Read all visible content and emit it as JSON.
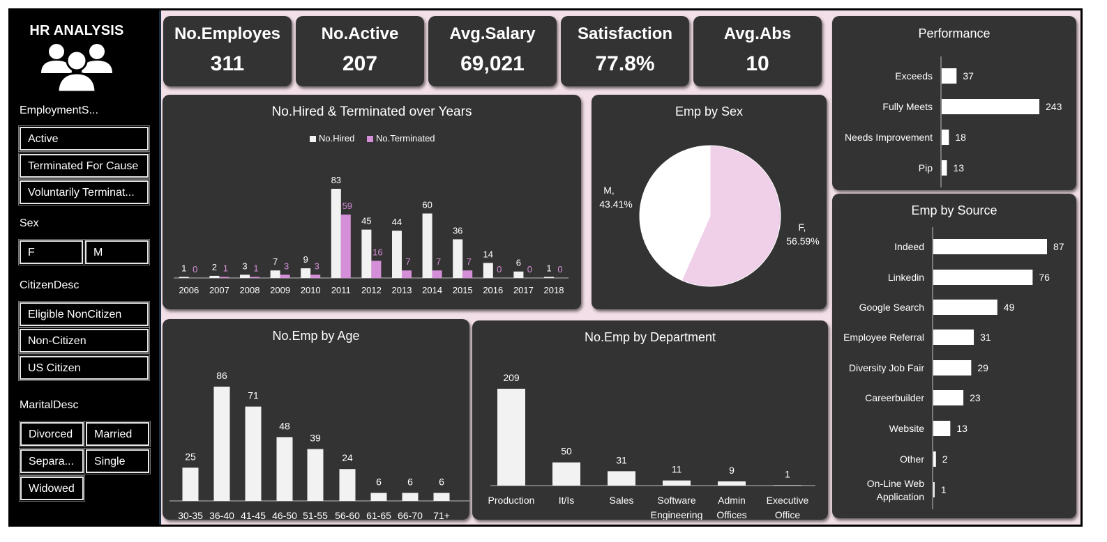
{
  "brand": {
    "title": "HR ANALYSIS",
    "icon": "people-group-icon"
  },
  "slicers": {
    "employment": {
      "title": "EmploymentS...",
      "items": [
        "Active",
        "Terminated For Cause",
        "Voluntarily Terminat..."
      ]
    },
    "sex": {
      "title": "Sex",
      "items": [
        "F",
        "M"
      ]
    },
    "citizen": {
      "title": "CitizenDesc",
      "items": [
        "Eligible NonCitizen",
        "Non-Citizen",
        "US Citizen"
      ]
    },
    "marital": {
      "title": "MaritalDesc",
      "items": [
        "Divorced",
        "Married",
        "Separa...",
        "Single",
        "Widowed"
      ]
    }
  },
  "kpis": [
    {
      "label": "No.Employes",
      "value": "311"
    },
    {
      "label": "No.Active",
      "value": "207"
    },
    {
      "label": "Avg.Salary",
      "value": "69,021"
    },
    {
      "label": "Satisfaction",
      "value": "77.8%"
    },
    {
      "label": "Avg.Abs",
      "value": "10"
    }
  ],
  "colors": {
    "background": "#f2dfe7",
    "card": "#333333",
    "hired": "#f2f2f2",
    "terminated": "#d58fd8",
    "female": "#f0cfe8",
    "male": "#ffffff"
  },
  "chart_data": [
    {
      "id": "hired_terminated",
      "type": "bar",
      "title": "No.Hired & Terminated over Years",
      "legend": "top",
      "categories": [
        "2006",
        "2007",
        "2008",
        "2009",
        "2010",
        "2011",
        "2012",
        "2013",
        "2014",
        "2015",
        "2016",
        "2017",
        "2018"
      ],
      "series": [
        {
          "name": "No.Hired",
          "values": [
            1,
            2,
            3,
            7,
            9,
            83,
            45,
            44,
            60,
            36,
            14,
            6,
            1
          ]
        },
        {
          "name": "No.Terminated",
          "values": [
            0,
            1,
            1,
            3,
            3,
            59,
            16,
            7,
            7,
            7,
            0,
            0,
            0
          ]
        }
      ]
    },
    {
      "id": "emp_by_sex",
      "type": "pie",
      "title": "Emp by Sex",
      "slices": [
        {
          "name": "F",
          "value": 56.59,
          "label": "F,",
          "pct": "56.59%"
        },
        {
          "name": "M",
          "value": 43.41,
          "label": "M,",
          "pct": "43.41%"
        }
      ]
    },
    {
      "id": "performance",
      "type": "bar",
      "orientation": "horizontal",
      "title": "Performance",
      "categories": [
        "Exceeds",
        "Fully Meets",
        "Needs Improvement",
        "Pip"
      ],
      "values": [
        37,
        243,
        18,
        13
      ]
    },
    {
      "id": "emp_by_source",
      "type": "bar",
      "orientation": "horizontal",
      "title": "Emp by Source",
      "categories": [
        "Indeed",
        "Linkedin",
        "Google Search",
        "Employee Referral",
        "Diversity Job Fair",
        "Careerbuilder",
        "Website",
        "Other",
        "On-Line Web Application"
      ],
      "values": [
        87,
        76,
        49,
        31,
        29,
        23,
        13,
        2,
        1
      ]
    },
    {
      "id": "emp_by_age",
      "type": "bar",
      "title": "No.Emp by Age",
      "categories": [
        "30-35",
        "36-40",
        "41-45",
        "46-50",
        "51-55",
        "56-60",
        "61-65",
        "66-70",
        "71+"
      ],
      "values": [
        25,
        86,
        71,
        48,
        39,
        24,
        6,
        6,
        6
      ]
    },
    {
      "id": "emp_by_department",
      "type": "bar",
      "title": "No.Emp by Department",
      "categories": [
        "Production",
        "It/Is",
        "Sales",
        "Software Engineering",
        "Admin Offices",
        "Executive Office"
      ],
      "values": [
        209,
        50,
        31,
        11,
        9,
        1
      ]
    }
  ]
}
